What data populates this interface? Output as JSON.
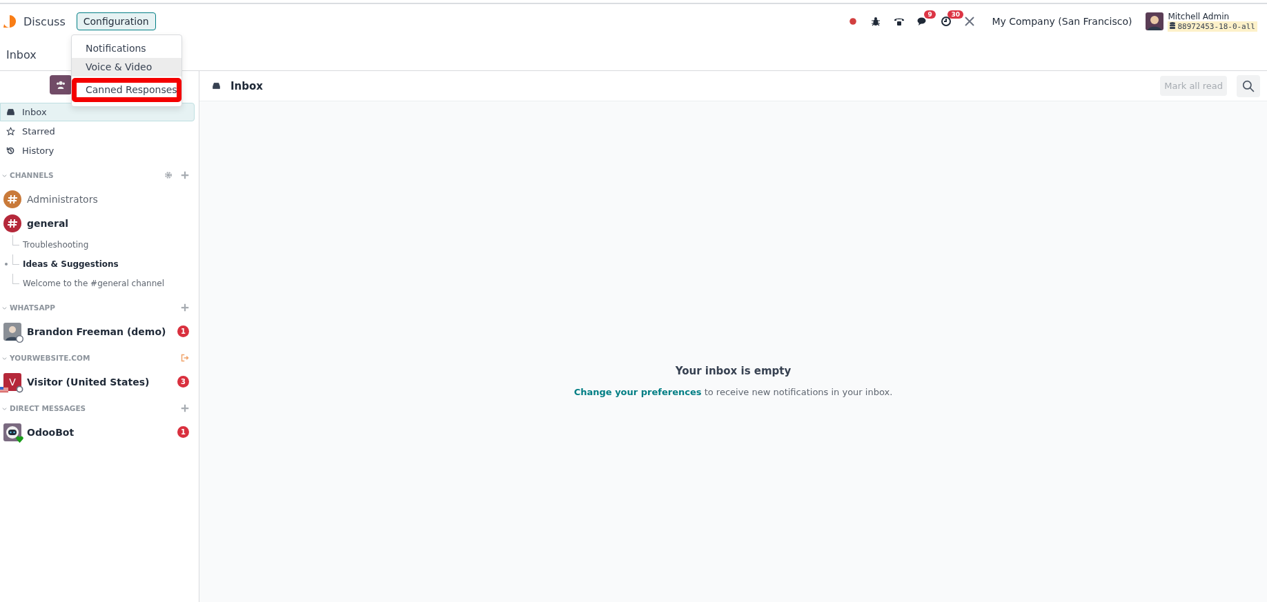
{
  "navbar": {
    "app_name": "Discuss",
    "menu": [
      {
        "label": "Configuration",
        "open": true
      }
    ],
    "dropdown": [
      {
        "label": "Notifications",
        "highlighted": false,
        "annotated": false
      },
      {
        "label": "Voice & Video",
        "highlighted": true,
        "annotated": false
      },
      {
        "label": "Canned Responses",
        "highlighted": false,
        "annotated": true
      }
    ],
    "systray": [
      {
        "kind": "record"
      },
      {
        "kind": "debug"
      },
      {
        "kind": "phone"
      },
      {
        "kind": "messages",
        "badge": "9"
      },
      {
        "kind": "activities",
        "badge": "30"
      },
      {
        "kind": "tools"
      }
    ],
    "company": "My Company (San Francisco)",
    "user": {
      "name": "Mitchell Admin",
      "database": "88972453-18-0-all"
    }
  },
  "breadcrumb": "Inbox",
  "sidebar": {
    "mailboxes": [
      {
        "kind": "inbox",
        "label": "Inbox",
        "selected": true
      },
      {
        "kind": "starred",
        "label": "Starred",
        "selected": false
      },
      {
        "kind": "history",
        "label": "History",
        "selected": false
      }
    ],
    "sections": [
      {
        "title": "CHANNELS",
        "actions": [
          {
            "kind": "settings"
          },
          {
            "kind": "add"
          }
        ],
        "items": [
          {
            "kind": "channel",
            "name": "Administrators",
            "color": "#c97a3a",
            "unread": false
          },
          {
            "kind": "channel",
            "name": "general",
            "color": "#b5283a",
            "unread": true,
            "children": [
              {
                "name": "Troubleshooting",
                "unread": false
              },
              {
                "name": "Ideas & Suggestions",
                "unread": true
              },
              {
                "name": "Welcome to the #general channel",
                "unread": false
              }
            ]
          }
        ]
      },
      {
        "title": "WHATSAPP",
        "actions": [
          {
            "kind": "add"
          }
        ],
        "items": [
          {
            "kind": "person",
            "name": "Brandon Freeman (demo)",
            "status": {
              "kind": "whatsapp"
            },
            "unread": true,
            "counter": "1"
          }
        ]
      },
      {
        "title": "YOURWEBSITE.COM",
        "actions": [
          {
            "kind": "leave"
          }
        ],
        "items": [
          {
            "kind": "visitor",
            "initial": "V",
            "name": "Visitor (United States)",
            "status": {
              "kind": "offline"
            },
            "flag": true,
            "unread": true,
            "counter": "3"
          }
        ]
      },
      {
        "title": "DIRECT MESSAGES",
        "actions": [
          {
            "kind": "add"
          }
        ],
        "items": [
          {
            "kind": "bot",
            "name": "OdooBot",
            "status": {
              "kind": "online"
            },
            "unread": true,
            "counter": "1"
          }
        ]
      }
    ]
  },
  "thread": {
    "title": "Inbox",
    "mark_all_read": {
      "label": "Mark all read",
      "disabled": true
    },
    "empty": {
      "title": "Your inbox is empty",
      "link": "Change your preferences",
      "text": "to receive new notifications in your inbox."
    }
  }
}
